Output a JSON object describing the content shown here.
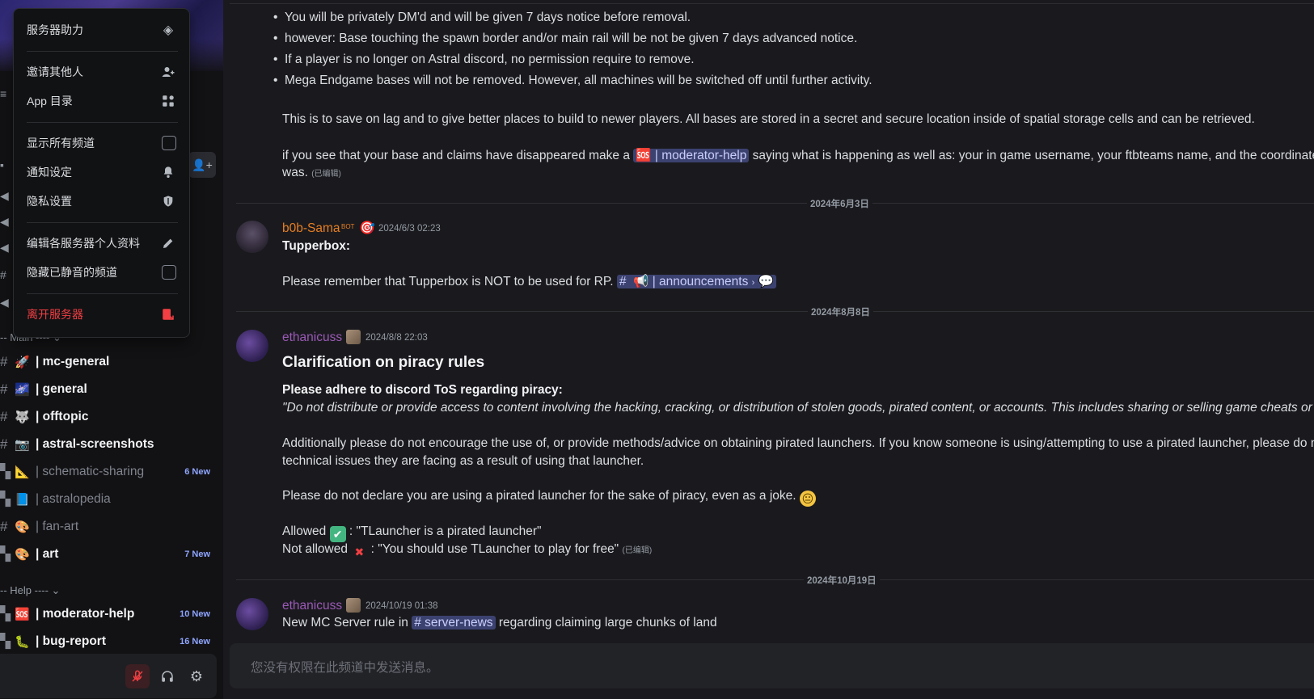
{
  "menu": {
    "items": [
      {
        "label": "服务器助力",
        "icon": "boost-icon"
      },
      {
        "label": "邀请其他人",
        "icon": "add-user-icon"
      },
      {
        "label": "App 目录",
        "icon": "app-directory-icon"
      },
      {
        "label": "显示所有频道",
        "icon": "checkbox"
      },
      {
        "label": "通知设定",
        "icon": "bell-icon"
      },
      {
        "label": "隐私设置",
        "icon": "shield-icon"
      },
      {
        "label": "编辑各服务器个人资料",
        "icon": "pencil-icon"
      },
      {
        "label": "隐藏已静音的频道",
        "icon": "checkbox"
      },
      {
        "label": "离开服务器",
        "icon": "leave-icon"
      }
    ]
  },
  "sidebar": {
    "categories": {
      "main": "-- Main ----",
      "help": "-- Help ----"
    },
    "channels": [
      {
        "emoji": "🚀",
        "name": "| mc-general",
        "badge": "",
        "state": "unread"
      },
      {
        "emoji": "🌌",
        "name": "| general",
        "badge": "",
        "state": "unread"
      },
      {
        "emoji": "🐺",
        "name": "| offtopic",
        "badge": "",
        "state": "unread"
      },
      {
        "emoji": "📷",
        "name": "| astral-screenshots",
        "badge": "",
        "state": "unread"
      },
      {
        "emoji": "📐",
        "name": "| schematic-sharing",
        "badge": "6 New",
        "state": "read"
      },
      {
        "emoji": "📘",
        "name": "| astralopedia",
        "badge": "",
        "state": "read"
      },
      {
        "emoji": "🎨",
        "name": "| fan-art",
        "badge": "",
        "state": "read"
      },
      {
        "emoji": "🎨",
        "name": "| art",
        "badge": "7 New",
        "state": "unread"
      },
      {
        "emoji": "🆘",
        "name": "| moderator-help",
        "badge": "10 New",
        "state": "unread"
      },
      {
        "emoji": "🐛",
        "name": "| bug-report",
        "badge": "16 New",
        "state": "unread"
      }
    ]
  },
  "messages": {
    "bullets": [
      "You will be privately DM'd and will be given 7 days notice before removal.",
      "however: Base touching the spawn border and/or main rail will be not be given 7 days advanced notice.",
      "If a player is no longer on Astral discord, no permission require to remove.",
      "Mega Endgame bases will not be removed. However, all machines will be switched off until further activity."
    ],
    "lag_note": "This is to save on lag and to give better places to build to newer players. All bases are stored in a secret and secure location inside of spatial storage cells and can be retrieved.",
    "disappeared_pre": "if you see that your base and claims have disappeared make a",
    "disappeared_mention": "| moderator-help",
    "disappeared_post": "saying what is happening as well as: your in game username, your ftbteams name, and the coordinates",
    "was": "was.",
    "edited": "(已编辑)",
    "date1": "2024年6月3日",
    "bob_name": "b0b-Sama",
    "bot_tag": "BOT",
    "bob_time": "2024/6/3 02:23",
    "tupperbox_title": "Tupperbox:",
    "tupperbox_text": "Please remember that Tupperbox is NOT to be used for RP.",
    "announcements_mention": "| announcements",
    "date2": "2024年8月8日",
    "eth_name": "ethanicuss",
    "eth_time1": "2024/8/8 22:03",
    "piracy_heading": "Clarification on piracy rules",
    "piracy_bold": "Please adhere to discord ToS regarding piracy:",
    "piracy_quote": "\"Do not distribute or provide access to content involving the hacking, cracking, or distribution of stolen goods, pirated content, or accounts. This includes  sharing or selling game cheats or ha",
    "launcher_line1": "Additionally please do not encourage the use of, or provide methods/advice on obtaining pirated launchers. If you know someone is using/attempting to use a pirated launcher, please do not",
    "launcher_line2": "technical issues they are facing as a result of using that launcher.",
    "joke_line": "Please do not declare you are using a pirated launcher for the sake of piracy, even as a joke.",
    "allowed_pre": "Allowed",
    "allowed_post": ": \"TLauncher is a pirated launcher\"",
    "not_allowed_pre": "Not allowed",
    "not_allowed_post": ": \"You should use TLauncher to play for free\"",
    "date3": "2024年10月19日",
    "eth_time2": "2024/10/19 01:38",
    "new_rule_pre": "New MC Server rule in",
    "server_news_mention": "# server-news",
    "new_rule_post": "regarding claiming large chunks of land"
  },
  "composer": {
    "placeholder": "您没有权限在此频道中发送消息。"
  },
  "colors": {
    "bob": "#e67e22",
    "ethan": "#9b59b6",
    "mention_bg": "#3c4270",
    "danger": "#f23f43"
  }
}
